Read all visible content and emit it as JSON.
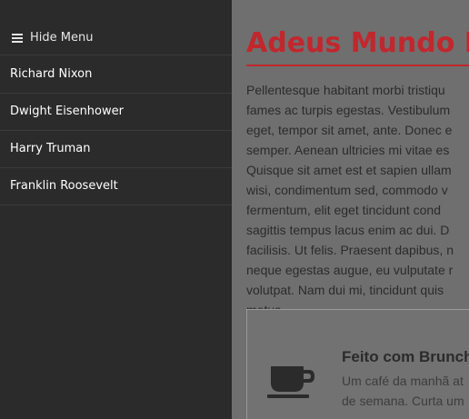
{
  "sidebar": {
    "toggle_label": "Hide Menu",
    "items": [
      {
        "label": "Richard Nixon"
      },
      {
        "label": "Dwight Eisenhower"
      },
      {
        "label": "Harry Truman"
      },
      {
        "label": "Franklin Roosevelt"
      }
    ]
  },
  "main": {
    "title": "Adeus Mundo Imu",
    "body_lines": "Pellentesque habitant morbi tristiqu\nfames ac turpis egestas. Vestibulum\neget, tempor sit amet, ante. Donec e\nsemper. Aenean ultricies mi vitae es\nQuisque sit amet est et sapien ullam\nwisi, condimentum sed, commodo v\nfermentum, elit eget tincidunt cond\nsagittis tempus lacus enim ac dui. D\nfacilisis. Ut felis. Praesent dapibus, n\nneque egestas augue, eu vulputate r\nvolutpat. Nam dui mi, tincidunt quis\nmetus",
    "card": {
      "icon": "coffee-cup-icon",
      "title": "Feito com Brunch",
      "text": "Um café da manhã at\nde semana. Curta um"
    }
  },
  "colors": {
    "sidebar_bg": "#2b2b2b",
    "main_bg": "#6f6f6f",
    "accent": "#c1272d"
  }
}
